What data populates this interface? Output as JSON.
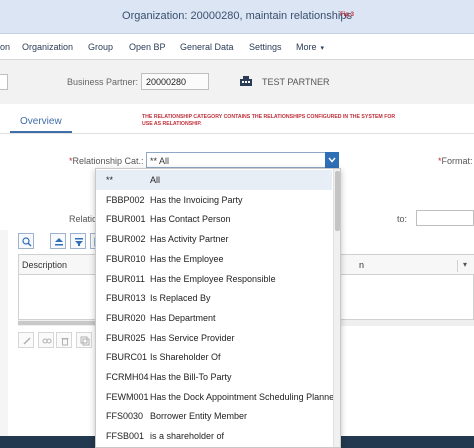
{
  "window": {
    "title": "Organization: 20000280, maintain relationships",
    "fig_label": "Fig 3"
  },
  "menu": [
    {
      "label": "on"
    },
    {
      "label": "Organization"
    },
    {
      "label": "Group"
    },
    {
      "label": "Open BP"
    },
    {
      "label": "General Data"
    },
    {
      "label": "Settings"
    },
    {
      "label": "More"
    }
  ],
  "header": {
    "bp_label": "Business Partner:",
    "bp_value": "20000280",
    "partner_icon": "partner-icon",
    "partner_name": "TEST PARTNER"
  },
  "tabs": {
    "overview": "Overview"
  },
  "annotation": "THE RELATIONSHIP CATEGORY CONTAINS THE RELATIONSHIPS CONFIGURED IN THE SYSTEM FOR USE AS RELATIONSHIP.",
  "form": {
    "required_mark": "*",
    "relationship_cat_label": "Relationship Cat.:",
    "relationship_cat_value": "** All",
    "format_label": "Format:",
    "relatio_label": "Relatio",
    "to_label": "to:"
  },
  "table": {
    "columns": [
      "Description",
      "n"
    ]
  },
  "dropdown": {
    "items": [
      {
        "code": "**",
        "text": "All",
        "selected": true
      },
      {
        "code": "FBBP002",
        "text": "Has the Invoicing Party"
      },
      {
        "code": "FBUR001",
        "text": "Has Contact Person"
      },
      {
        "code": "FBUR002",
        "text": "Has Activity Partner"
      },
      {
        "code": "FBUR010",
        "text": "Has the Employee"
      },
      {
        "code": "FBUR011",
        "text": "Has the Employee Responsible"
      },
      {
        "code": "FBUR013",
        "text": "Is Replaced By"
      },
      {
        "code": "FBUR020",
        "text": "Has Department"
      },
      {
        "code": "FBUR025",
        "text": "Has Service Provider"
      },
      {
        "code": "FBURC01",
        "text": "Is Shareholder Of"
      },
      {
        "code": "FCRMH04",
        "text": "Has the Bill-To Party"
      },
      {
        "code": "FEWM001",
        "text": "Has the Dock Appointment Scheduling Planner"
      },
      {
        "code": "FFS0030",
        "text": "Borrower Entity Member"
      },
      {
        "code": "FFSB001",
        "text": "is a shareholder of"
      }
    ]
  },
  "colors": {
    "accent": "#2f6fb6",
    "annotation": "#c0303a",
    "titlebar": "#dbe5f3",
    "footer": "#22394f"
  }
}
